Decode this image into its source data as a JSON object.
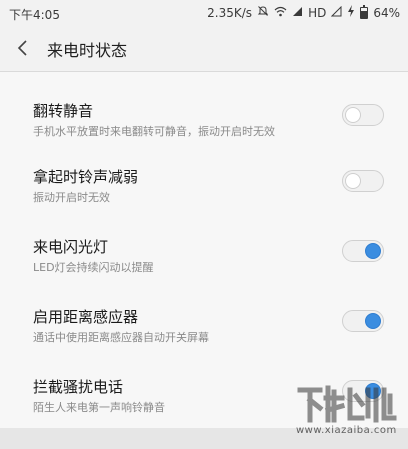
{
  "status_bar": {
    "time": "下午4:05",
    "speed": "2.35K/s",
    "network": "HD",
    "battery": "64%",
    "battery_level": 0.64
  },
  "header": {
    "title": "来电时状态"
  },
  "settings": [
    {
      "title": "翻转静音",
      "subtitle": "手机水平放置时来电翻转可静音，振动开启时无效",
      "enabled": false
    },
    {
      "title": "拿起时铃声减弱",
      "subtitle": "振动开启时无效",
      "enabled": false
    },
    {
      "title": "来电闪光灯",
      "subtitle": "LED灯会持续闪动以提醒",
      "enabled": true
    },
    {
      "title": "启用距离感应器",
      "subtitle": "通话中使用距离感应器自动开关屏幕",
      "enabled": true
    },
    {
      "title": "拦截骚扰电话",
      "subtitle": "陌生人来电第一声响铃静音",
      "enabled": true
    }
  ],
  "watermark": {
    "url": "www.xiazaiba.com"
  },
  "colors": {
    "accent": "#3b8de0"
  }
}
